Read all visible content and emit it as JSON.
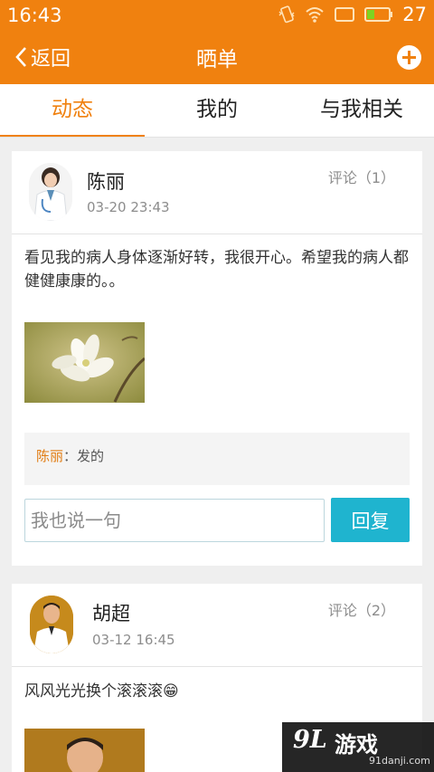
{
  "status_bar": {
    "time": "16:43",
    "battery_level": "27"
  },
  "nav": {
    "back_label": "返回",
    "title": "晒单"
  },
  "tabs": [
    {
      "label": "动态",
      "active": true
    },
    {
      "label": "我的",
      "active": false
    },
    {
      "label": "与我相关",
      "active": false
    }
  ],
  "posts": [
    {
      "author": "陈丽",
      "time": "03-20 23:43",
      "comments_label": "评论（1）",
      "content": "看见我的病人身体逐渐好转，我很开心。希望我的病人都健健康康的。。",
      "replies": [
        {
          "who": "陈丽",
          "sep": "：",
          "text": "发的"
        }
      ],
      "reply_placeholder": "我也说一句",
      "reply_button": "回复"
    },
    {
      "author": "胡超",
      "time": "03-12 16:45",
      "comments_label": "评论（2）",
      "content": "风风光光换个滚滚滚😁"
    }
  ],
  "watermark": {
    "logo": "9L",
    "text": "游戏",
    "url": "91danji.com"
  },
  "colors": {
    "brand_orange": "#f0810f",
    "reply_blue": "#1fb4cf"
  },
  "icons": [
    "back-chevron-icon",
    "add-icon",
    "vibrate-icon",
    "wifi-icon",
    "sim-icon",
    "battery-icon"
  ]
}
